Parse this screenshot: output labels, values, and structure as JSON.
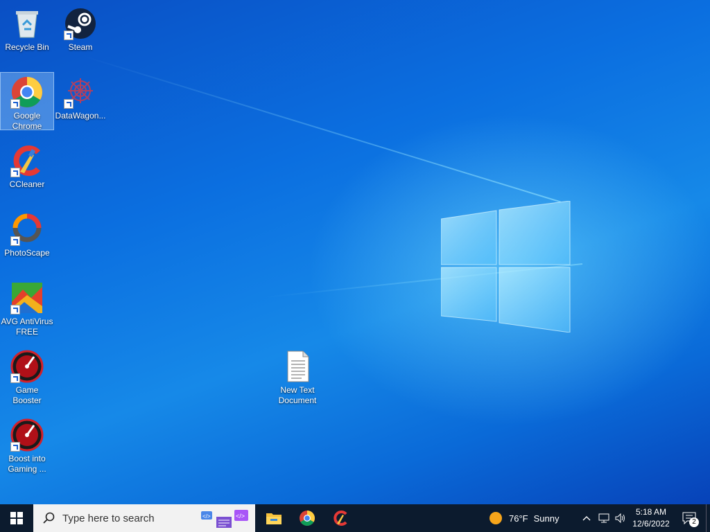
{
  "desktop": {
    "icons": [
      {
        "label": "Recycle Bin",
        "icon": "recycle-bin-icon"
      },
      {
        "label": "Steam",
        "icon": "steam-icon"
      },
      {
        "label": "Google Chrome",
        "icon": "chrome-icon"
      },
      {
        "label": "DataWagon...",
        "icon": "datawagon-icon"
      },
      {
        "label": "CCleaner",
        "icon": "ccleaner-icon"
      },
      {
        "label": "PhotoScape",
        "icon": "photoscape-icon"
      },
      {
        "label": "AVG AntiVirus FREE",
        "icon": "avg-icon"
      },
      {
        "label": "Game Booster",
        "icon": "game-booster-icon"
      },
      {
        "label": "Boost into Gaming ...",
        "icon": "boost-gaming-icon"
      },
      {
        "label": "New Text Document",
        "icon": "text-document-icon"
      }
    ]
  },
  "taskbar": {
    "search_placeholder": "Type here to search",
    "weather": {
      "temp": "76°F",
      "condition": "Sunny"
    },
    "clock": {
      "time": "5:18 AM",
      "date": "12/6/2022"
    },
    "notification_count": "2",
    "pinned": [
      "file-explorer-icon",
      "chrome-icon",
      "ccleaner-icon"
    ]
  },
  "colors": {
    "taskbar": "#0c1b2e",
    "desktop_accent": "#0b6fe0"
  }
}
